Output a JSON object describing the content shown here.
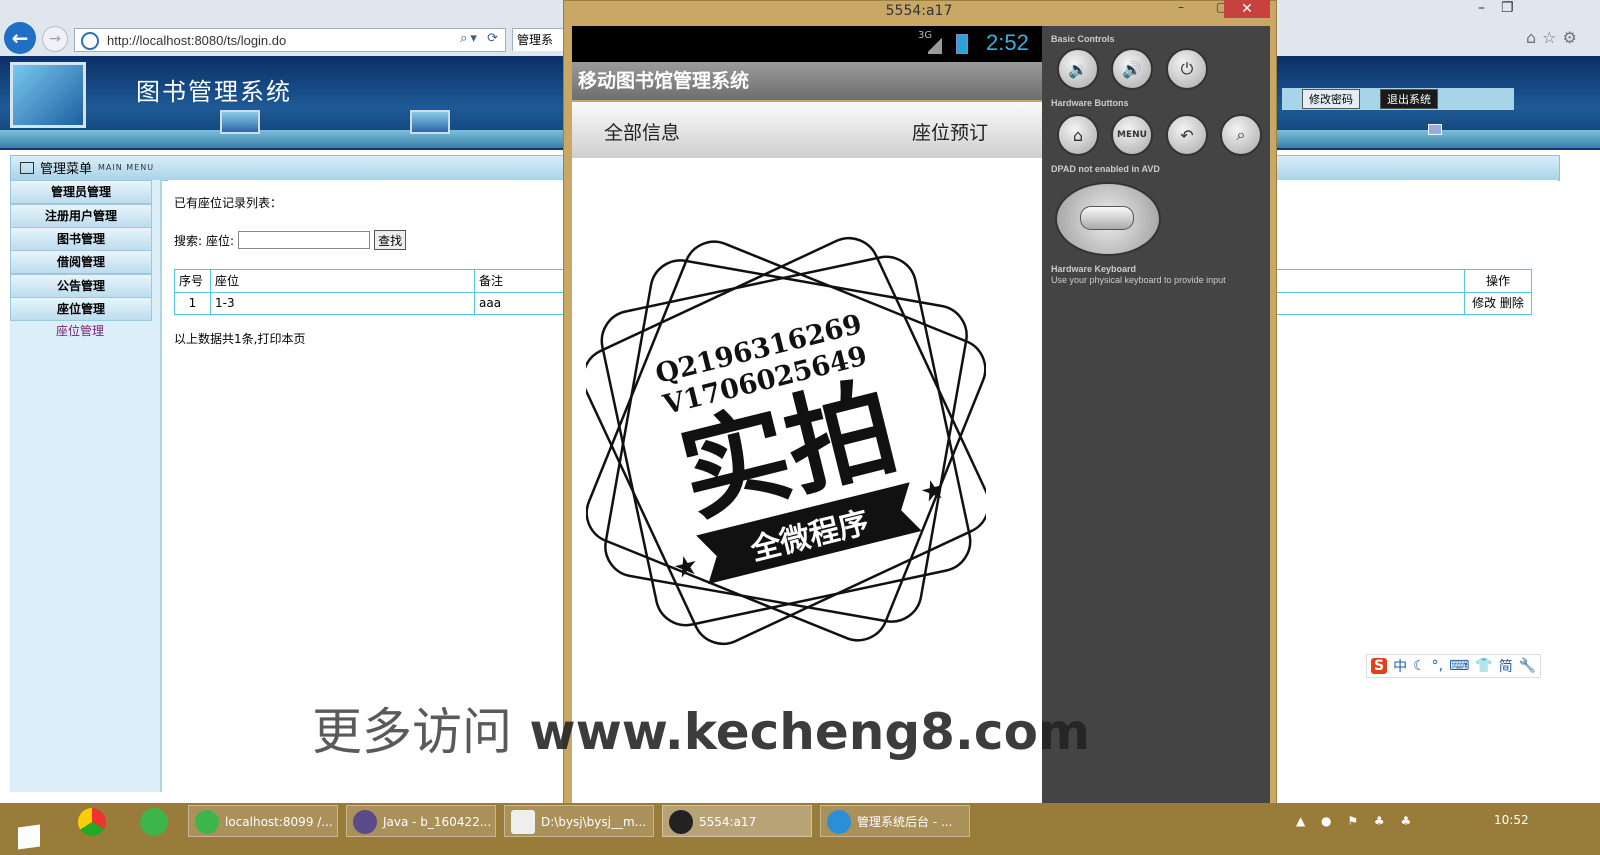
{
  "browser": {
    "address": "http://localhost:8080/ts/login.do",
    "tab_label": "管理系",
    "addr_tools": "⌕▾ ⟳",
    "right_icons": "⌂☆⚙",
    "win_controls": "–❐"
  },
  "app": {
    "title": "图书管理系统",
    "change_password": "修改密码",
    "logout": "退出系统",
    "menu_title": "管理菜单",
    "menu_title_en": "MAIN MENU"
  },
  "sidebar": {
    "items": [
      {
        "label": "管理员管理"
      },
      {
        "label": "注册用户管理"
      },
      {
        "label": "图书管理"
      },
      {
        "label": "借阅管理"
      },
      {
        "label": "公告管理"
      },
      {
        "label": "座位管理"
      }
    ],
    "sub_item": "座位管理"
  },
  "content": {
    "records_title": "已有座位记录列表：",
    "search_label": "搜索:",
    "seat_label": "座位:",
    "search_value": "",
    "search_button": "查找",
    "table": {
      "headers": {
        "no": "序号",
        "seat": "座位",
        "note": "备注",
        "ops": "操作"
      },
      "rows": [
        {
          "no": "1",
          "seat": "1-3",
          "note": "aaa",
          "edit": "修改",
          "delete": "删除"
        }
      ]
    },
    "summary": "以上数据共1条,打印本页"
  },
  "emulator": {
    "window_title": "5554:a17",
    "status_network": "3G",
    "status_time": "2:52",
    "app_title": "移动图书馆管理系统",
    "tabs": [
      "全部信息",
      "座位预订"
    ],
    "panel": {
      "basic_controls": "Basic Controls",
      "hardware_buttons": "Hardware Buttons",
      "dpad_note": "DPAD not enabled in AVD",
      "keyboard_title": "Hardware Keyboard",
      "keyboard_note": "Use your physical keyboard to provide input",
      "menu_label": "MENU"
    }
  },
  "stamp": {
    "line1": "Q2196316269",
    "line2": "V1706025649",
    "big": "实拍",
    "ribbon": "全微程序"
  },
  "watermark": {
    "cn": "更多访问",
    "url": "www.kecheng8.com"
  },
  "taskbar": {
    "tasks": [
      {
        "label": "localhost:8099 /..."
      },
      {
        "label": "Java - b_160422..."
      },
      {
        "label": "D:\\bysj\\bysj__m..."
      },
      {
        "label": "5554:a17"
      },
      {
        "label": "管理系统后台 - ..."
      }
    ],
    "time": "10:52"
  },
  "ime": {
    "s": "S",
    "zh": "中",
    "jian": "简"
  },
  "colors": {
    "header_blue": "#1e5a96",
    "table_border": "#56c6e0",
    "emulator_frame": "#c9a866",
    "close_red": "#c7413f",
    "status_time": "#38b0e0"
  }
}
